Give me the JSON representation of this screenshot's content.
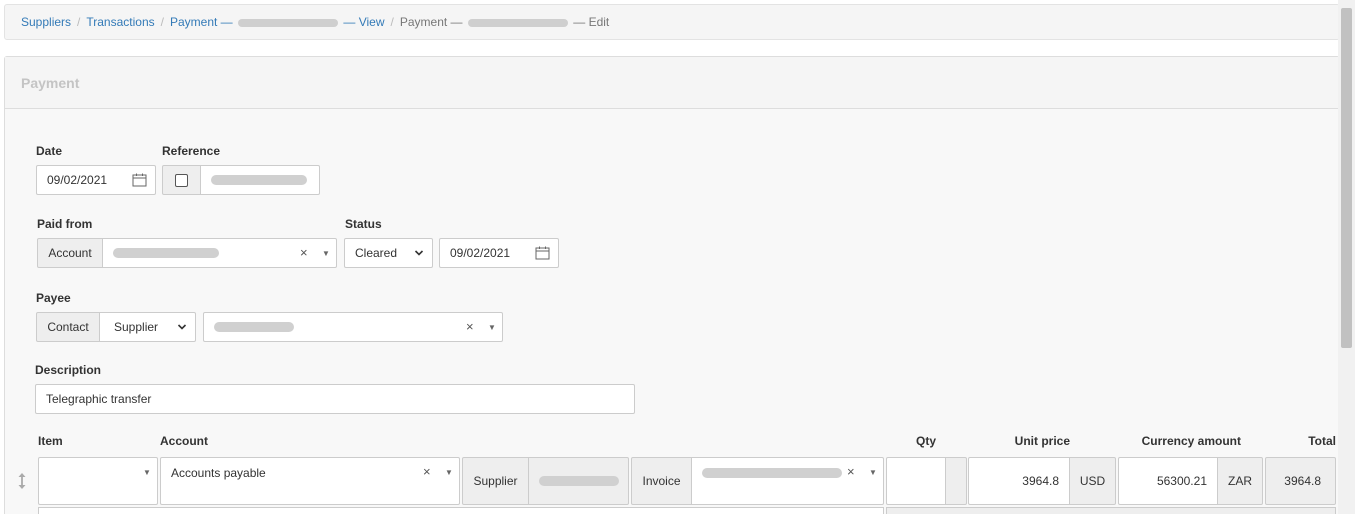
{
  "breadcrumb": {
    "suppliers": "Suppliers",
    "transactions": "Transactions",
    "payment_view_prefix": "Payment —",
    "payment_view_suffix": "— View",
    "payment_edit_prefix": "Payment —",
    "payment_edit_suffix": "— Edit",
    "separator": "/"
  },
  "panel": {
    "title": "Payment"
  },
  "form": {
    "date_label": "Date",
    "date_value": "09/02/2021",
    "reference_label": "Reference",
    "paid_from_label": "Paid from",
    "account_addon": "Account",
    "status_label": "Status",
    "status_value": "Cleared",
    "status_date": "09/02/2021",
    "payee_label": "Payee",
    "contact_addon": "Contact",
    "contact_type": "Supplier",
    "description_label": "Description",
    "description_value": "Telegraphic transfer"
  },
  "table": {
    "headers": {
      "item": "Item",
      "account": "Account",
      "qty": "Qty",
      "unit_price": "Unit price",
      "currency_amount": "Currency amount",
      "total": "Total"
    },
    "row": {
      "account": "Accounts payable",
      "supplier_addon": "Supplier",
      "invoice_addon": "Invoice",
      "unit_price": "3964.8",
      "unit_currency": "USD",
      "currency_amount": "56300.21",
      "amount_currency": "ZAR",
      "total": "3964.8"
    }
  },
  "icons": {
    "calendar": "calendar-icon",
    "clear": "clear-icon",
    "caret": "caret-down-icon",
    "chevron": "chevron-down-icon",
    "drag": "drag-handle-icon"
  },
  "colors": {
    "link": "#337ab7",
    "addon_bg": "#eeeeee",
    "panel_bg": "#f8f8f8"
  }
}
